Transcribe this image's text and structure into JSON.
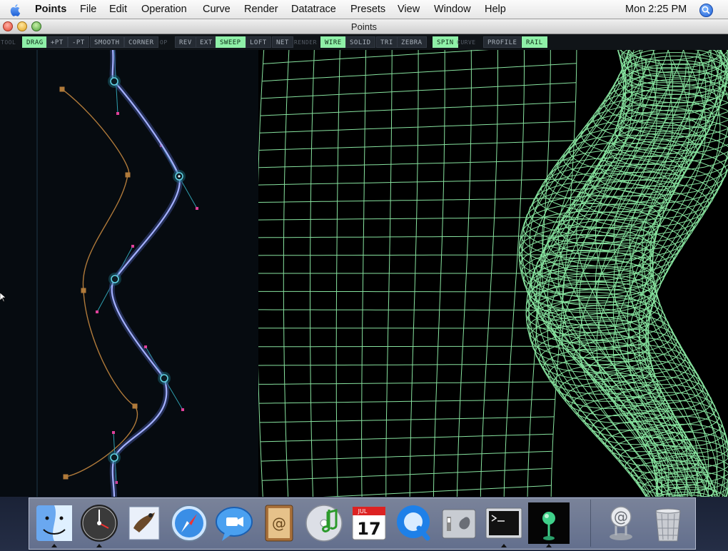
{
  "menubar": {
    "app_name": "Points",
    "items": [
      "File",
      "Edit",
      "Operation",
      "Curve",
      "Render",
      "Datatrace",
      "Presets",
      "View",
      "Window",
      "Help"
    ],
    "clock": "Mon 2:25 PM"
  },
  "window": {
    "title": "Points"
  },
  "toolbar": {
    "groups": [
      {
        "label": "TOOL",
        "buttons": [
          {
            "label": "DRAG",
            "active": true
          },
          {
            "label": "+PT",
            "active": false
          },
          {
            "label": "-PT",
            "active": false
          },
          {
            "label": "SMOOTH",
            "active": false
          },
          {
            "label": "CORNER",
            "active": false
          }
        ]
      },
      {
        "label": "OP",
        "buttons": [
          {
            "label": "REV",
            "active": false
          },
          {
            "label": "EXT",
            "active": false
          },
          {
            "label": "SWEEP",
            "active": true
          },
          {
            "label": "LOFT",
            "active": false
          },
          {
            "label": "NET",
            "active": false
          }
        ]
      },
      {
        "label": "RENDER",
        "buttons": [
          {
            "label": "WIRE",
            "active": true
          },
          {
            "label": "SOLID",
            "active": false
          },
          {
            "label": "TRI",
            "active": false
          },
          {
            "label": "ZEBRA",
            "active": false
          },
          {
            "label": "SPIN",
            "active": true
          }
        ]
      },
      {
        "label": "CURVE",
        "buttons": [
          {
            "label": "PROFILE",
            "active": false
          },
          {
            "label": "RAIL",
            "active": true
          }
        ]
      }
    ]
  },
  "colors": {
    "active_button": "#8ff0a8",
    "wireframe": "#8ff0a8",
    "profile_curve": "#9aa6ff",
    "rail_curve": "#b07a3a",
    "handle_point": "#e0409a",
    "anchor_ring": "#5fd0e0"
  },
  "dock": {
    "icons": [
      {
        "name": "finder-icon",
        "running": true
      },
      {
        "name": "dashboard-icon",
        "running": true
      },
      {
        "name": "mail-icon",
        "running": false
      },
      {
        "name": "safari-icon",
        "running": false
      },
      {
        "name": "ichat-icon",
        "running": false
      },
      {
        "name": "address-book-icon",
        "running": false
      },
      {
        "name": "itunes-icon",
        "running": false
      },
      {
        "name": "ical-icon",
        "running": false,
        "badge_month": "JUL",
        "badge_day": "17"
      },
      {
        "name": "quicktime-icon",
        "running": false
      },
      {
        "name": "system-preferences-icon",
        "running": false
      },
      {
        "name": "terminal-icon",
        "running": true
      },
      {
        "name": "points-app-icon",
        "running": true
      },
      {
        "name": "internet-connect-icon",
        "running": false
      },
      {
        "name": "trash-icon",
        "running": false
      }
    ]
  }
}
